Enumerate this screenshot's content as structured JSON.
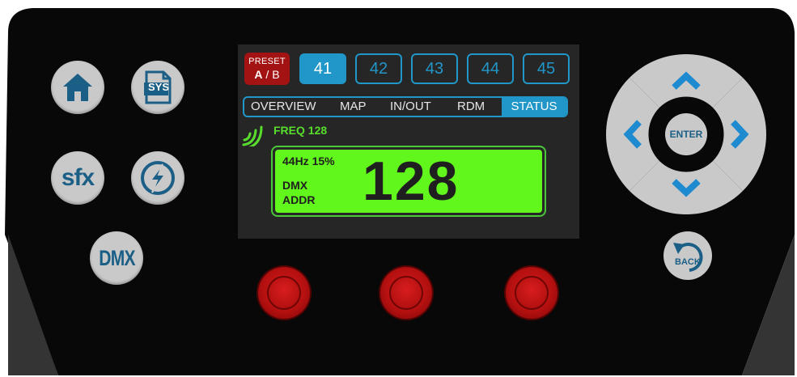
{
  "left_buttons": {
    "home": {
      "icon": "home-icon"
    },
    "sys": {
      "label": "SYS",
      "icon": "sys-file-icon"
    },
    "sfx": {
      "label": "sfx"
    },
    "flash": {
      "icon": "lightning-icon"
    },
    "dmx": {
      "label": "DMX"
    }
  },
  "screen": {
    "preset": {
      "title": "PRESET",
      "a": "A",
      "sep": " / ",
      "b": "B",
      "color": "#a31313"
    },
    "number_tabs": [
      {
        "label": "41",
        "active": true
      },
      {
        "label": "42",
        "active": false
      },
      {
        "label": "43",
        "active": false
      },
      {
        "label": "44",
        "active": false
      },
      {
        "label": "45",
        "active": false
      }
    ],
    "nav_tabs": [
      {
        "label": "OVERVIEW",
        "active": false
      },
      {
        "label": "MAP",
        "active": false
      },
      {
        "label": "IN/OUT",
        "active": false
      },
      {
        "label": "RDM",
        "active": false
      },
      {
        "label": "STATUS",
        "active": true
      }
    ],
    "freq": {
      "label": "FREQ 128",
      "icon": "wireless-signal-icon",
      "color": "#58dd2c"
    },
    "lcd": {
      "line1": "44Hz 15%",
      "line2": "DMX",
      "line3": "ADDR",
      "value": "128",
      "color": "#61f61c"
    }
  },
  "dpad": {
    "enter_label": "ENTER",
    "up_icon": "chevron-up-icon",
    "down_icon": "chevron-down-icon",
    "left_icon": "chevron-left-icon",
    "right_icon": "chevron-right-icon"
  },
  "back": {
    "label": "BACK",
    "icon": "back-arrow-icon"
  },
  "colors": {
    "accent": "#2196c8",
    "icon_blue": "#1b5f86",
    "button_gray": "#c9c9c9",
    "knob_red": "#c01414",
    "panel": "#080808"
  }
}
